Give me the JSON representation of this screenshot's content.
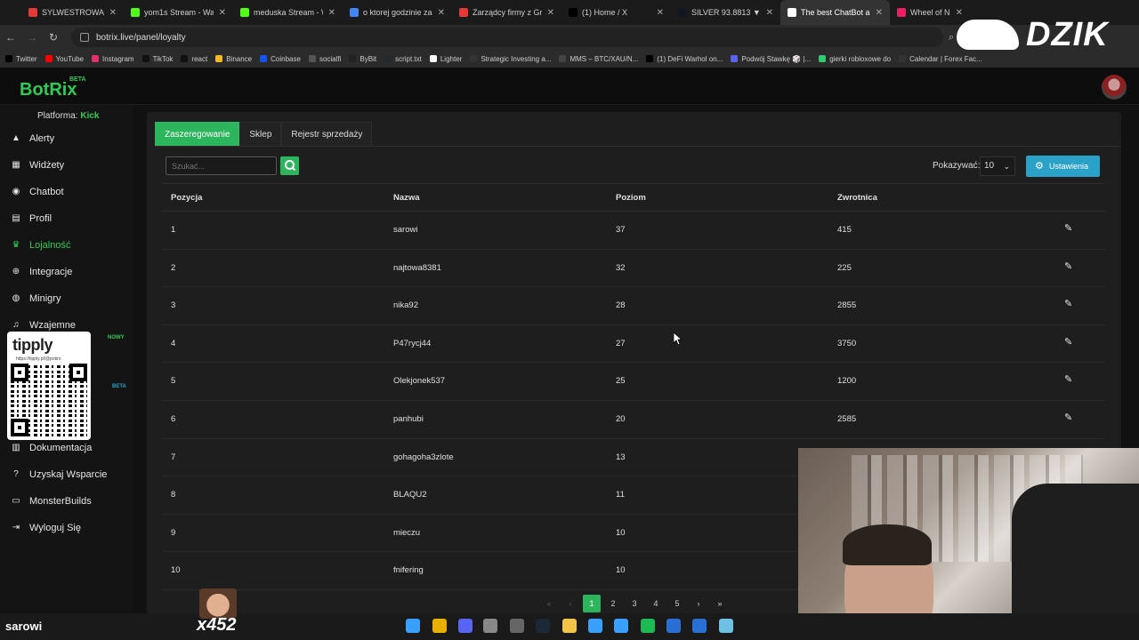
{
  "browser": {
    "tabs": [
      {
        "label": "SYLWESTROWA S",
        "color": "#e53935"
      },
      {
        "label": "yom1s Stream - Watc",
        "color": "#53fc18"
      },
      {
        "label": "meduska Stream - W",
        "color": "#53fc18"
      },
      {
        "label": "o ktorej godzinie zam",
        "color": "#4285f4"
      },
      {
        "label": "Zarządcy firmy z Gru",
        "color": "#e53935"
      },
      {
        "label": "(1) Home / X",
        "color": "#000000"
      },
      {
        "label": "SILVER 93.8813 ▼ -1",
        "color": "#131722"
      },
      {
        "label": "The best ChatBot and",
        "color": "#ffffff"
      },
      {
        "label": "Wheel of Na",
        "color": "#e91e63"
      }
    ],
    "url": "botrix.live/panel/loyalty",
    "bookmarks": [
      {
        "label": "Twitter",
        "color": "#000000"
      },
      {
        "label": "YouTube",
        "color": "#ff0000"
      },
      {
        "label": "Instagram",
        "color": "#e1306c"
      },
      {
        "label": "TikTok",
        "color": "#111111"
      },
      {
        "label": "react",
        "color": "#111111"
      },
      {
        "label": "Binance",
        "color": "#f3ba2f"
      },
      {
        "label": "Coinbase",
        "color": "#1652f0"
      },
      {
        "label": "socialfi",
        "color": "#555555"
      },
      {
        "label": "ByBit",
        "color": "#222222"
      },
      {
        "label": "script.txt",
        "color": "#24292e"
      },
      {
        "label": "Lighter",
        "color": "#ffffff"
      },
      {
        "label": "Strategic Investing a...",
        "color": "#333333"
      },
      {
        "label": "MMS – BTC/XAU/N...",
        "color": "#444444"
      },
      {
        "label": "(1) DeFi Warhol on...",
        "color": "#000000"
      },
      {
        "label": "Podwój Stawkę 🎲 |...",
        "color": "#5865f2"
      },
      {
        "label": "gierki robloxowe do",
        "color": "#2ecc71"
      },
      {
        "label": "Calendar | Forex Fac...",
        "color": "#333333"
      }
    ]
  },
  "overlay": {
    "brand": "DZIK",
    "tipply_logo": "tipply",
    "tipply_url": "https://tipply.pl/@potiro",
    "viewer_name": "sarowi",
    "viewer_count": "x452"
  },
  "app": {
    "logo": "BotRix",
    "logo_badge": "BETA",
    "platform_label": "Platforma:",
    "platform_value": "Kick",
    "accent": "#2ecc55"
  },
  "sidebar": {
    "items": [
      {
        "label": "Alerty",
        "icon": "warning-icon"
      },
      {
        "label": "Widżety",
        "icon": "grid-icon"
      },
      {
        "label": "Chatbot",
        "icon": "robot-icon"
      },
      {
        "label": "Profil",
        "icon": "id-card-icon"
      },
      {
        "label": "Lojalność",
        "icon": "trophy-icon",
        "active": true
      },
      {
        "label": "Integracje",
        "icon": "plug-icon"
      },
      {
        "label": "Minigry",
        "icon": "gamepad-icon"
      },
      {
        "label": "Wzajemne",
        "icon": "music-icon"
      },
      {
        "label": "Dokumentacja",
        "icon": "book-icon"
      },
      {
        "label": "Uzyskaj Wsparcie",
        "icon": "help-icon"
      },
      {
        "label": "MonsterBuilds",
        "icon": "monitor-icon"
      },
      {
        "label": "Wyloguj Się",
        "icon": "logout-icon"
      }
    ],
    "badge_new": "NOWY",
    "badge_beta": "BETA"
  },
  "panel": {
    "tabs": [
      "Zaszeregowanie",
      "Sklep",
      "Rejestr sprzedaży"
    ],
    "active_tab": 0,
    "search_placeholder": "Szukać...",
    "show_label": "Pokazywać:",
    "show_value": "10",
    "settings_label": "Ustawienia"
  },
  "table": {
    "columns": [
      "Pozycja",
      "Nazwa",
      "Poziom",
      "Zwrotnica"
    ],
    "rows": [
      {
        "pos": "1",
        "name": "sarowi",
        "level": "37",
        "points": "415"
      },
      {
        "pos": "2",
        "name": "najtowa8381",
        "level": "32",
        "points": "225"
      },
      {
        "pos": "3",
        "name": "nika92",
        "level": "28",
        "points": "2855"
      },
      {
        "pos": "4",
        "name": "P47rycj44",
        "level": "27",
        "points": "3750"
      },
      {
        "pos": "5",
        "name": "Olekjonek537",
        "level": "25",
        "points": "1200"
      },
      {
        "pos": "6",
        "name": "panhubi",
        "level": "20",
        "points": "2585"
      },
      {
        "pos": "7",
        "name": "gohagoha3zlote",
        "level": "13",
        "points": ""
      },
      {
        "pos": "8",
        "name": "BLAQU2",
        "level": "11",
        "points": ""
      },
      {
        "pos": "9",
        "name": "mieczu",
        "level": "10",
        "points": ""
      },
      {
        "pos": "10",
        "name": "fnifering",
        "level": "10",
        "points": ""
      }
    ]
  },
  "pagination": {
    "pages": [
      "1",
      "2",
      "3",
      "4",
      "5"
    ],
    "current": "1"
  }
}
